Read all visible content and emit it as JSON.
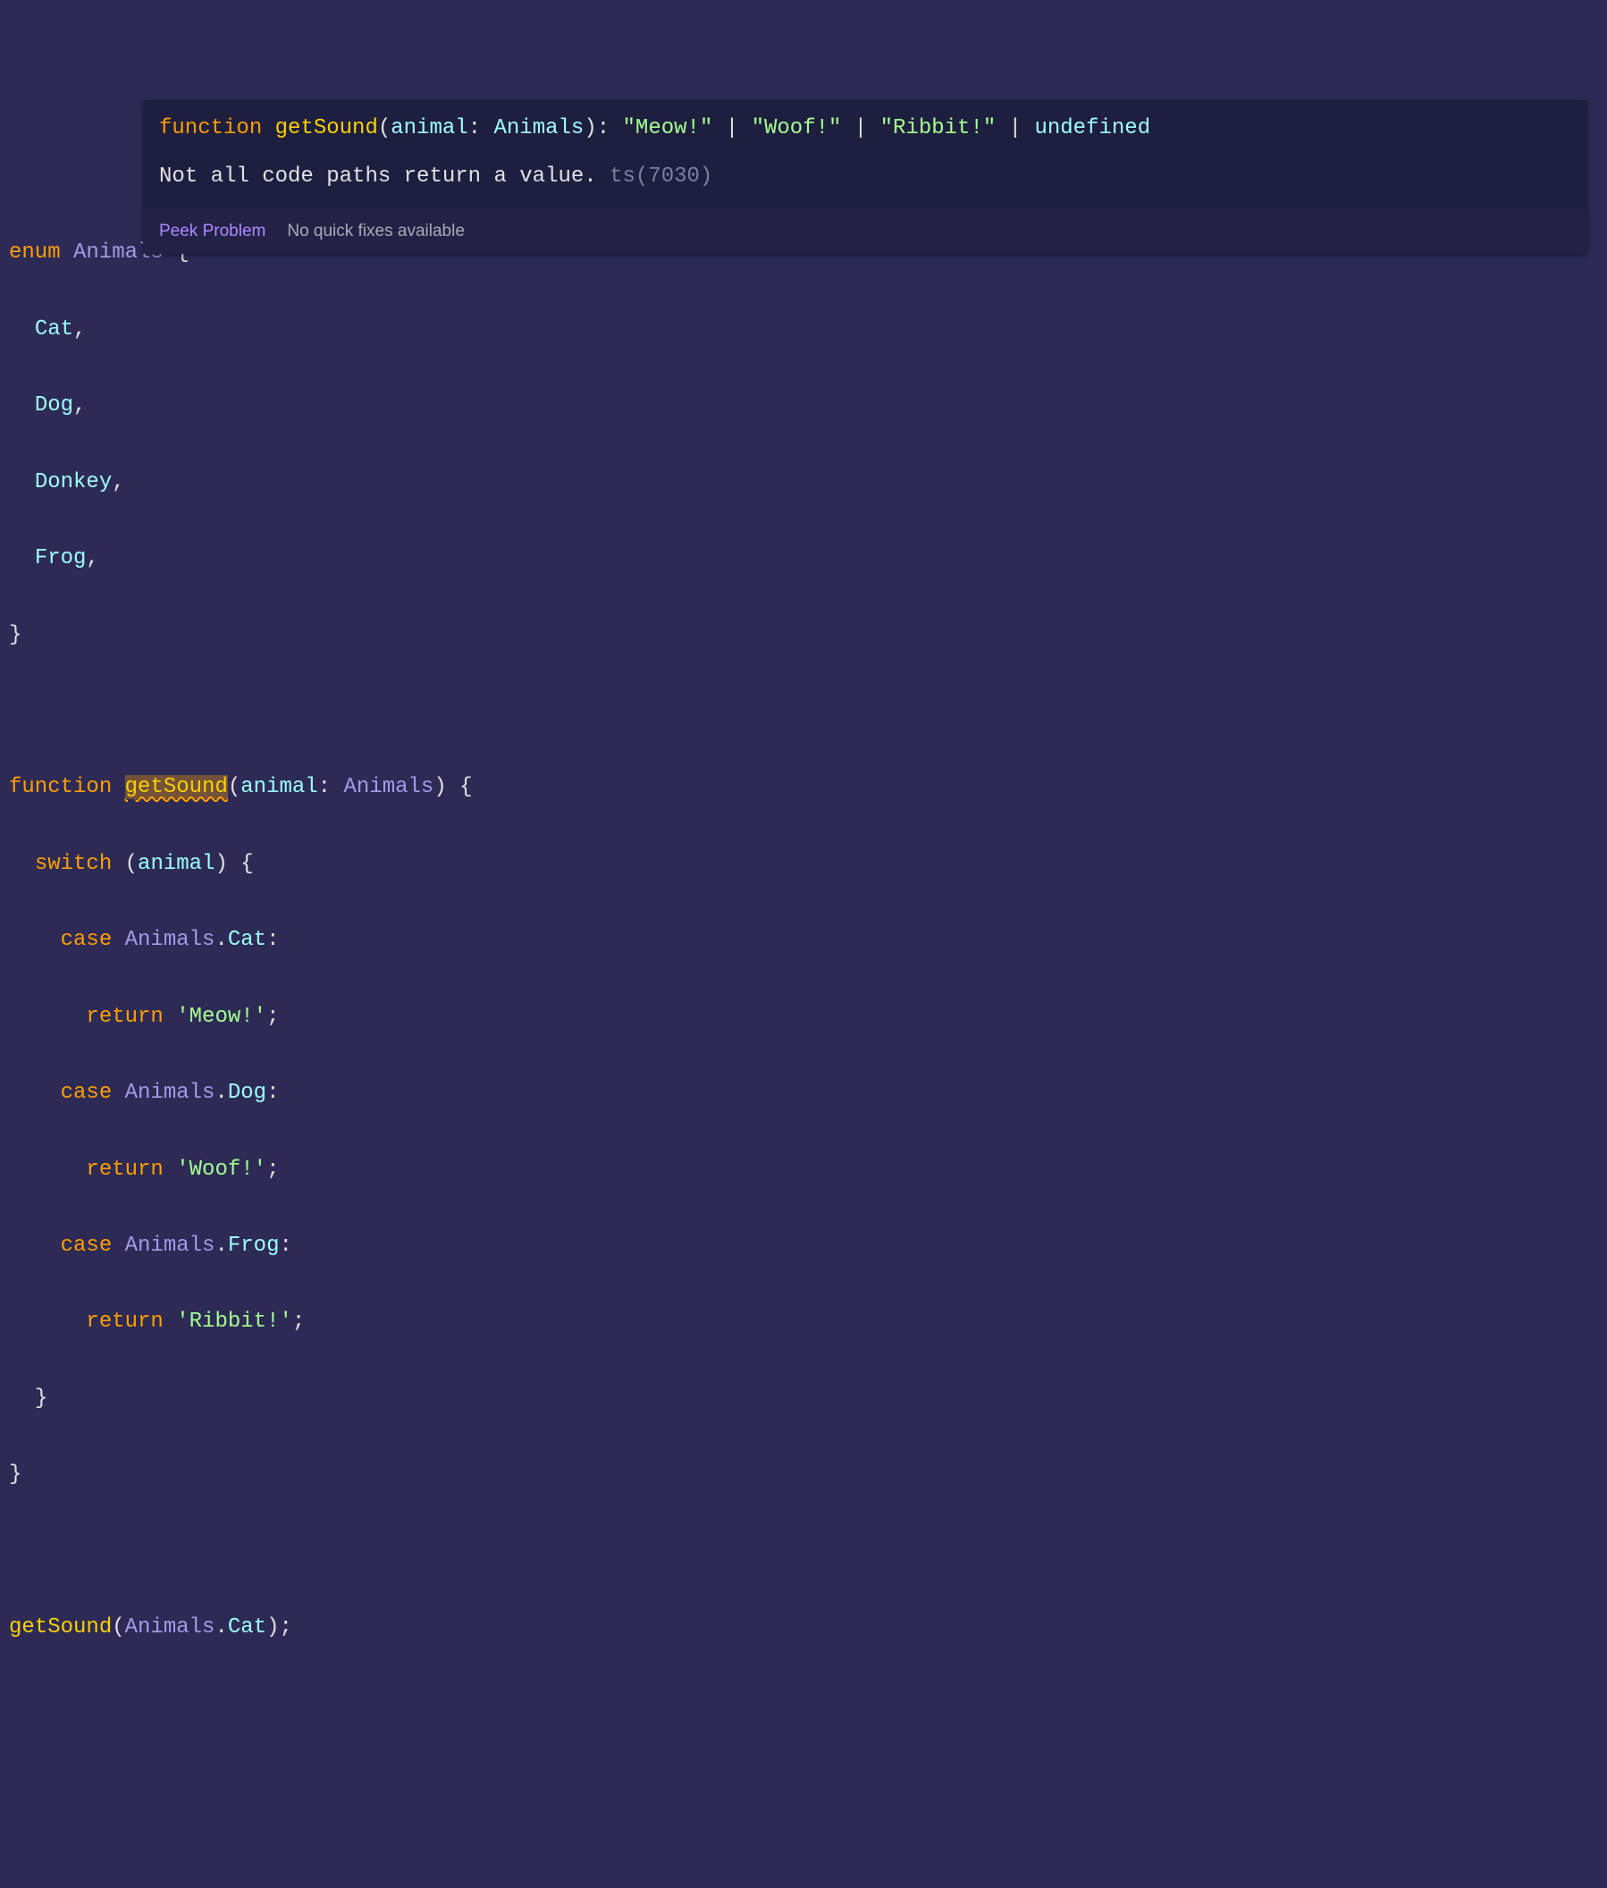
{
  "code": {
    "l1_kw_enum": "enum",
    "l1_type": "Animals",
    "l1_brace": "{",
    "l2_val": "Cat",
    "l3_val": "Dog",
    "l4_val": "Donkey",
    "l5_val": "Frog",
    "l6_brace": "}",
    "l8_kw_fn": "function",
    "l8_fnname": "getSound",
    "l8_param": "animal",
    "l8_ptype": "Animals",
    "l8_brace": "{",
    "l9_kw_switch": "switch",
    "l9_var": "animal",
    "l9_brace": "{",
    "l10_kw_case": "case",
    "l10_obj": "Animals",
    "l10_prop": "Cat",
    "l11_kw_ret": "return",
    "l11_str": "'Meow!'",
    "l12_kw_case": "case",
    "l12_obj": "Animals",
    "l12_prop": "Dog",
    "l13_kw_ret": "return",
    "l13_str": "'Woof!'",
    "l14_kw_case": "case",
    "l14_obj": "Animals",
    "l14_prop": "Frog",
    "l15_kw_ret": "return",
    "l15_str": "'Ribbit!'",
    "l16_brace": "}",
    "l17_brace": "}",
    "l19_fn": "getSound",
    "l19_obj": "Animals",
    "l19_prop": "Cat"
  },
  "hover": {
    "sig_kw_fn": "function",
    "sig_fnname": "getSound",
    "sig_param": "animal",
    "sig_ptype": "Animals",
    "sig_r1": "\"Meow!\"",
    "sig_r2": "\"Woof!\"",
    "sig_r3": "\"Ribbit!\"",
    "sig_undef": "undefined",
    "msg_text": "Not all code paths return a value.",
    "msg_code": "ts(7030)",
    "peek_label": "Peek Problem",
    "noquick_label": "No quick fixes available"
  }
}
